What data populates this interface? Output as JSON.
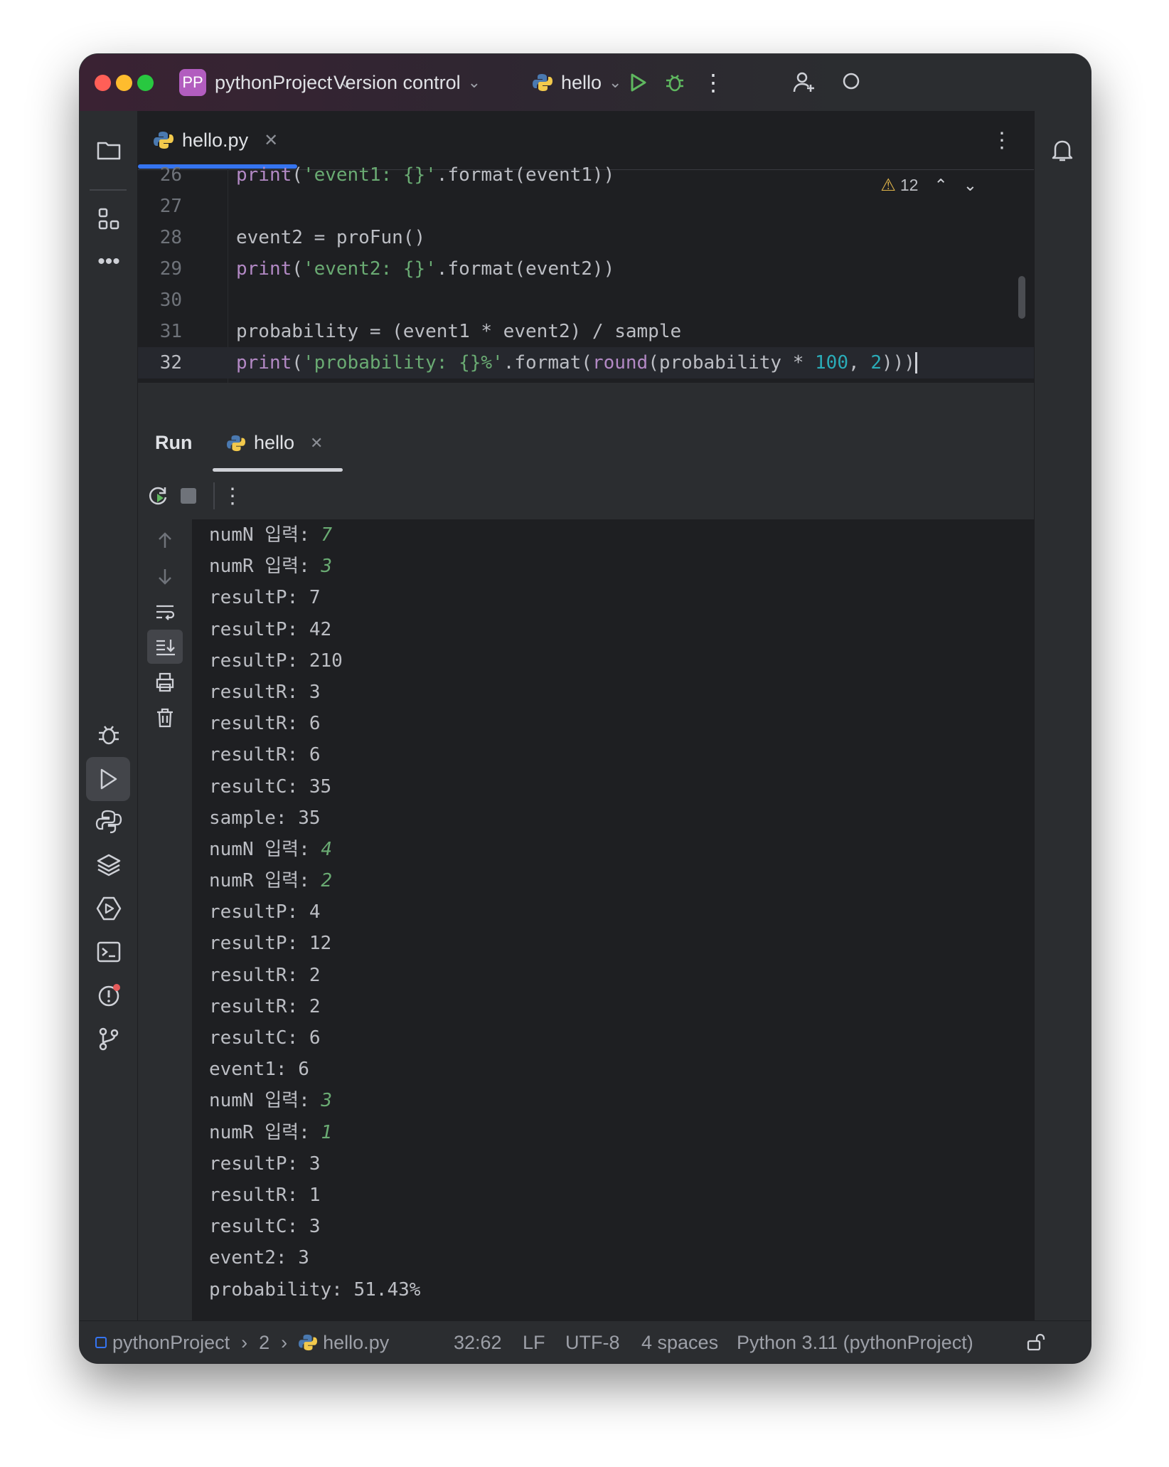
{
  "titlebar": {
    "project_badge": "PP",
    "project_name": "pythonProject",
    "version_control": "Version control",
    "run_config": "hello"
  },
  "editor": {
    "tab_label": "hello.py",
    "warnings_count": "12",
    "lines": [
      {
        "num": "26",
        "text": "print('event1: {}'.format(event1))"
      },
      {
        "num": "27",
        "text": ""
      },
      {
        "num": "28",
        "text": "event2 = proFun()"
      },
      {
        "num": "29",
        "text": "print('event2: {}'.format(event2))"
      },
      {
        "num": "30",
        "text": ""
      },
      {
        "num": "31",
        "text": "probability = (event1 * event2) / sample"
      },
      {
        "num": "32",
        "text": "print('probability: {}%'.format(round(probability * 100, 2)))"
      }
    ]
  },
  "run": {
    "panel_title": "Run",
    "tab_label": "hello",
    "output": [
      {
        "prefix": "numN 입력: ",
        "input": "7"
      },
      {
        "prefix": "numR 입력: ",
        "input": "3"
      },
      {
        "prefix": "resultP: 7"
      },
      {
        "prefix": "resultP: 42"
      },
      {
        "prefix": "resultP: 210"
      },
      {
        "prefix": "resultR: 3"
      },
      {
        "prefix": "resultR: 6"
      },
      {
        "prefix": "resultR: 6"
      },
      {
        "prefix": "resultC: 35"
      },
      {
        "prefix": "sample: 35"
      },
      {
        "prefix": "numN 입력: ",
        "input": "4"
      },
      {
        "prefix": "numR 입력: ",
        "input": "2"
      },
      {
        "prefix": "resultP: 4"
      },
      {
        "prefix": "resultP: 12"
      },
      {
        "prefix": "resultR: 2"
      },
      {
        "prefix": "resultR: 2"
      },
      {
        "prefix": "resultC: 6"
      },
      {
        "prefix": "event1: 6"
      },
      {
        "prefix": "numN 입력: ",
        "input": "3"
      },
      {
        "prefix": "numR 입력: ",
        "input": "1"
      },
      {
        "prefix": "resultP: 3"
      },
      {
        "prefix": "resultR: 1"
      },
      {
        "prefix": "resultC: 3"
      },
      {
        "prefix": "event2: 3"
      },
      {
        "prefix": "probability: 51.43%"
      }
    ]
  },
  "statusbar": {
    "project": "pythonProject",
    "crumb_2": "2",
    "file": "hello.py",
    "position": "32:62",
    "line_ending": "LF",
    "encoding": "UTF-8",
    "indent": "4 spaces",
    "interpreter": "Python 3.11 (pythonProject)"
  },
  "colors": {
    "accent": "#3574f0",
    "input_text": "#6aab73",
    "badge": "#b25dbf"
  }
}
